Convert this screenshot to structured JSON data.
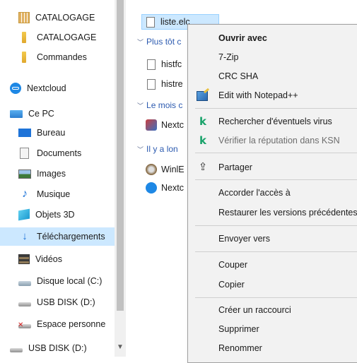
{
  "nav": {
    "items": [
      {
        "label": "CATALOGAGE",
        "icon": "catalog-folder-icon"
      },
      {
        "label": "CATALOGAGE",
        "icon": "folder-icon"
      },
      {
        "label": "Commandes",
        "icon": "folder-icon"
      },
      {
        "label": "Nextcloud",
        "icon": "nextcloud-icon"
      },
      {
        "label": "Ce PC",
        "icon": "this-pc-icon"
      },
      {
        "label": "Bureau",
        "icon": "desktop-icon"
      },
      {
        "label": "Documents",
        "icon": "documents-icon"
      },
      {
        "label": "Images",
        "icon": "images-icon"
      },
      {
        "label": "Musique",
        "icon": "music-icon"
      },
      {
        "label": "Objets 3D",
        "icon": "objects-3d-icon"
      },
      {
        "label": "Téléchargements",
        "icon": "downloads-icon",
        "selected": true
      },
      {
        "label": "Vidéos",
        "icon": "videos-icon"
      },
      {
        "label": "Disque local (C:)",
        "icon": "local-disk-icon"
      },
      {
        "label": "USB DISK (D:)",
        "icon": "usb-drive-icon"
      },
      {
        "label": "Espace personne",
        "icon": "network-drive-icon"
      },
      {
        "label": "USB DISK (D:)",
        "icon": "usb-drive-icon"
      }
    ]
  },
  "files": {
    "selected_file": "liste.elc",
    "groups": [
      {
        "label": "Plus tôt c",
        "items": [
          "histfc",
          "histre"
        ]
      },
      {
        "label": "Le mois c",
        "items": [
          "Nextc"
        ]
      },
      {
        "label": "Il y a lon",
        "items": [
          "WinlE",
          "Nextc"
        ]
      }
    ]
  },
  "context_menu": {
    "items": [
      {
        "label": "Ouvrir avec",
        "bold": true
      },
      {
        "label": "7-Zip"
      },
      {
        "label": "CRC SHA"
      },
      {
        "label": "Edit with Notepad++",
        "icon": "notepad-plus-plus-icon"
      },
      {
        "label": "Rechercher d'éventuels virus",
        "icon": "kaspersky-icon"
      },
      {
        "label": "Vérifier la réputation dans KSN",
        "icon": "kaspersky-icon",
        "disabled": true
      },
      {
        "label": "Partager",
        "icon": "share-icon"
      },
      {
        "label": "Accorder l'accès à"
      },
      {
        "label": "Restaurer les versions précédentes"
      },
      {
        "label": "Envoyer vers"
      },
      {
        "label": "Couper"
      },
      {
        "label": "Copier"
      },
      {
        "label": "Créer un raccourci"
      },
      {
        "label": "Supprimer"
      },
      {
        "label": "Renommer"
      }
    ]
  },
  "colors": {
    "selection": "#cce8ff",
    "group_header": "#2d5bb0",
    "menu_background": "#f2f2f2",
    "kaspersky": "#1aa36b"
  }
}
